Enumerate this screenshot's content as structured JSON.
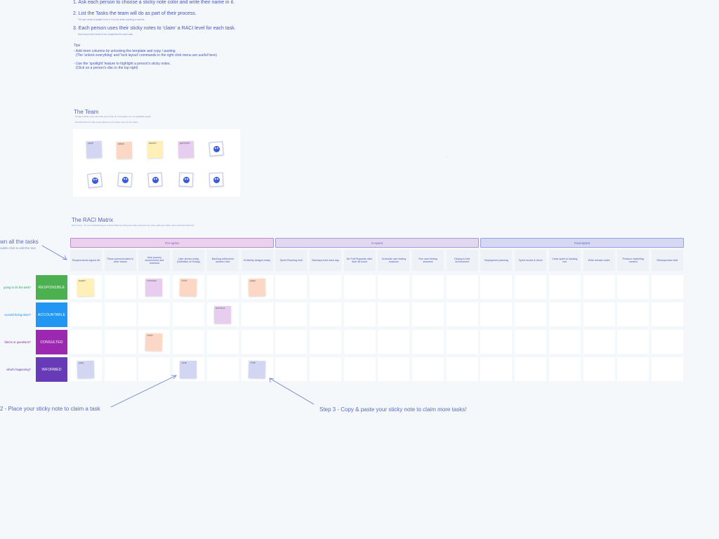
{
  "instructions": {
    "step1": "1. Ask each person to choose a sticky note color and write their name in it.",
    "step2": "2. List the Tasks the team will do as part of their process.",
    "step2_sub": "The per-mode example is for a 3-to-am team working in sprints",
    "step3": "3. Each person uses their sticky notes to ‘claim’ a RACI level for each task.",
    "step3_sub": "Not every level needs to be completed for each task.",
    "tips_title": "Tips",
    "tip1": "- Add more columns by unlocking the template and copy / pasting.\n  (The 'unlock everything' and 'lock layout' commands in the right click menu are useful here)",
    "tip2": "- Use the 'spotlight' feature to highlight a person's sticky notes.\n  (Click on a person's disc in the top right)"
  },
  "team": {
    "title": "The Team",
    "sub1": "Create a sticky note color with your name on it and place it on an available space.",
    "sub2": "Ctrl-D/cmd-D to make extra copies of your sticky note for the matrix.",
    "notes": [
      {
        "name": "JANE",
        "color": "#d3d6f3"
      },
      {
        "name": "ANNA",
        "color": "#fdd7c5"
      },
      {
        "name": "RANDY",
        "color": "#fff0b8"
      },
      {
        "name": "NATASHA",
        "color": "#e7cdf0"
      }
    ]
  },
  "matrix": {
    "title": "The RACI Matrix",
    "sub": "Don't worry - it's not overwhelming so it starts filled by writing the tasks along the top, then grab your sticky notes and start claiming!",
    "phases": [
      {
        "label": "Pre-sprint",
        "bg": "#ecd1ef",
        "border": "#b98bd0",
        "color": "#8b5aa8"
      },
      {
        "label": "In-sprint",
        "bg": "#e3d8f2",
        "border": "#a899d8",
        "color": "#6e5fb8"
      },
      {
        "label": "Post-Sprint",
        "bg": "#d7d9f4",
        "border": "#9aa0de",
        "color": "#5a63b8"
      }
    ],
    "tasks": [
      "Requirements signed off",
      "Plans communicated to other teams",
      "User journey documented and reviewed",
      "User stories ready (Definition of Ready)",
      "Backlog refinement session held",
      "Hi-fidelity designs ready",
      "Sprint Planning held",
      "Standups held each day",
      "No Pull Requests older than 48 hours",
      "Schedule user testing sessions",
      "Run user testing sessions",
      "Deploy to test environment",
      "Deployment planning",
      "Sprint review & demo",
      "Close sprint in backlog tool",
      "Write release notes",
      "Produce marketing content",
      "Retrospective held"
    ],
    "roles": [
      {
        "label": "RESPONSIBLE",
        "color": "#4caf50",
        "question": "going to do the task?",
        "qcolor": "#2e9e5a"
      },
      {
        "label": "ACCOUNTABLE",
        "color": "#2196f3",
        "question": "ou task being done?",
        "qcolor": "#1e88e5"
      },
      {
        "label": "CONSULTED",
        "color": "#9c27b0",
        "question": "blems or questions?",
        "qcolor": "#8e24aa"
      },
      {
        "label": "INFORMED",
        "color": "#673ab7",
        "question": "what's happening?",
        "qcolor": "#5e35b1"
      }
    ],
    "claims": [
      {
        "row": 0,
        "col": 0,
        "name": "RANDY",
        "color": "#fff0b8"
      },
      {
        "row": 0,
        "col": 2,
        "name": "NATASHA",
        "color": "#e7cdf0"
      },
      {
        "row": 0,
        "col": 3,
        "name": "ANNA",
        "color": "#fdd7c5"
      },
      {
        "row": 0,
        "col": 5,
        "name": "ANNA",
        "color": "#fdd7c5"
      },
      {
        "row": 1,
        "col": 4,
        "name": "NATASHA",
        "color": "#e7cdf0"
      },
      {
        "row": 2,
        "col": 2,
        "name": "ANNA",
        "color": "#fdd7c5"
      },
      {
        "row": 3,
        "col": 0,
        "name": "JANE",
        "color": "#d3d6f3"
      },
      {
        "row": 3,
        "col": 3,
        "name": "JANE",
        "color": "#d3d6f3"
      },
      {
        "row": 3,
        "col": 5,
        "name": "JANE",
        "color": "#d3d6f3"
      }
    ]
  },
  "annotations": {
    "step1_title": "wn all the tasks",
    "step1_sub": "ouble-click to edit the text",
    "step2": "2 - Place your sticky note to claim a task",
    "step3": "Step 3 - Copy & paste your sticky note to claim more tasks!"
  }
}
